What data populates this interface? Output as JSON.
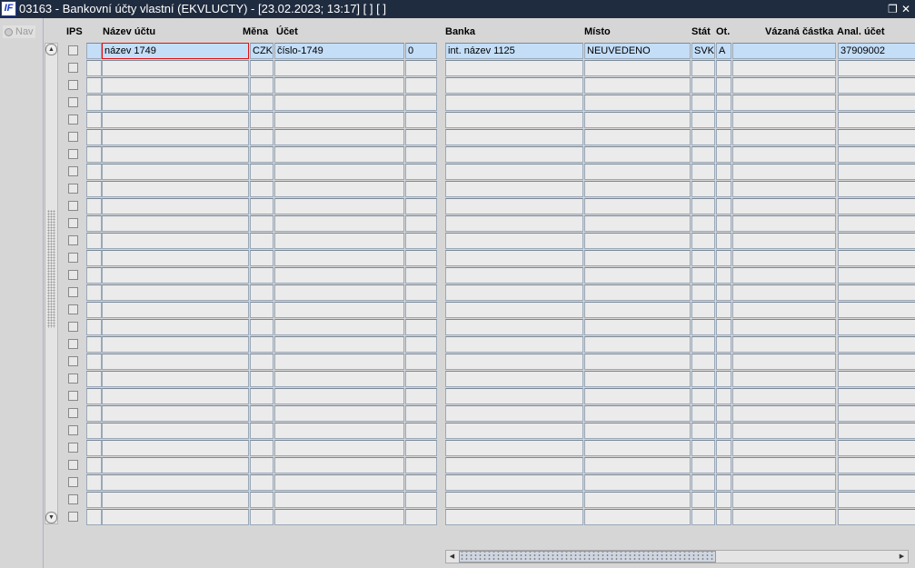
{
  "window": {
    "title": "03163 - Bankovní účty vlastní (EKVLUCTY) - [23.02.2023; 13:17]  [ ]  [ ]",
    "logo": "IF",
    "restore_icon": "❐",
    "close_icon": "✕"
  },
  "nav": {
    "label": "Nav"
  },
  "headers": {
    "ips": "IPS",
    "nazev": "Název účtu",
    "mena": "Měna",
    "ucet": "Účet",
    "banka": "Banka",
    "misto": "Místo",
    "stat": "Stát",
    "ot": "Ot.",
    "vazana": "Vázaná částka",
    "anal": "Anal. účet"
  },
  "row_count": 28,
  "rows": [
    {
      "nazev": "název 1749",
      "mena": "CZK",
      "ucet": "číslo-1749",
      "cislo": "0",
      "banka": "int. název 1125",
      "misto": "NEUVEDENO",
      "stat": "SVK",
      "ot": "A",
      "vazana": "",
      "anal": "37909002"
    }
  ],
  "colors": {
    "selected_row": "#c4def8",
    "focus_border": "#e01010"
  }
}
